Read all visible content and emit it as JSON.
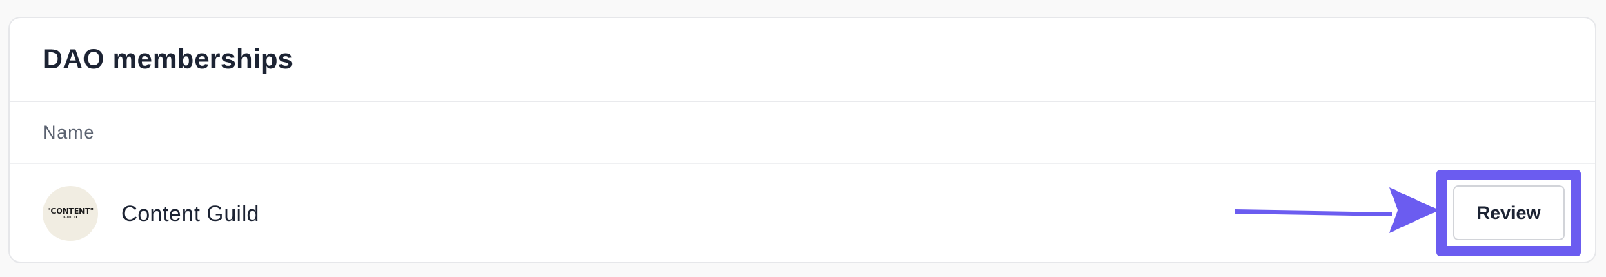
{
  "card": {
    "title": "DAO memberships"
  },
  "table": {
    "columns": [
      "Name"
    ],
    "rows": [
      {
        "name": "Content Guild",
        "avatar_text_main": "\"CONTENT\"",
        "avatar_text_sub": "GUILD",
        "action_label": "Review"
      }
    ]
  },
  "annotation": {
    "color": "#6b5cf0"
  }
}
